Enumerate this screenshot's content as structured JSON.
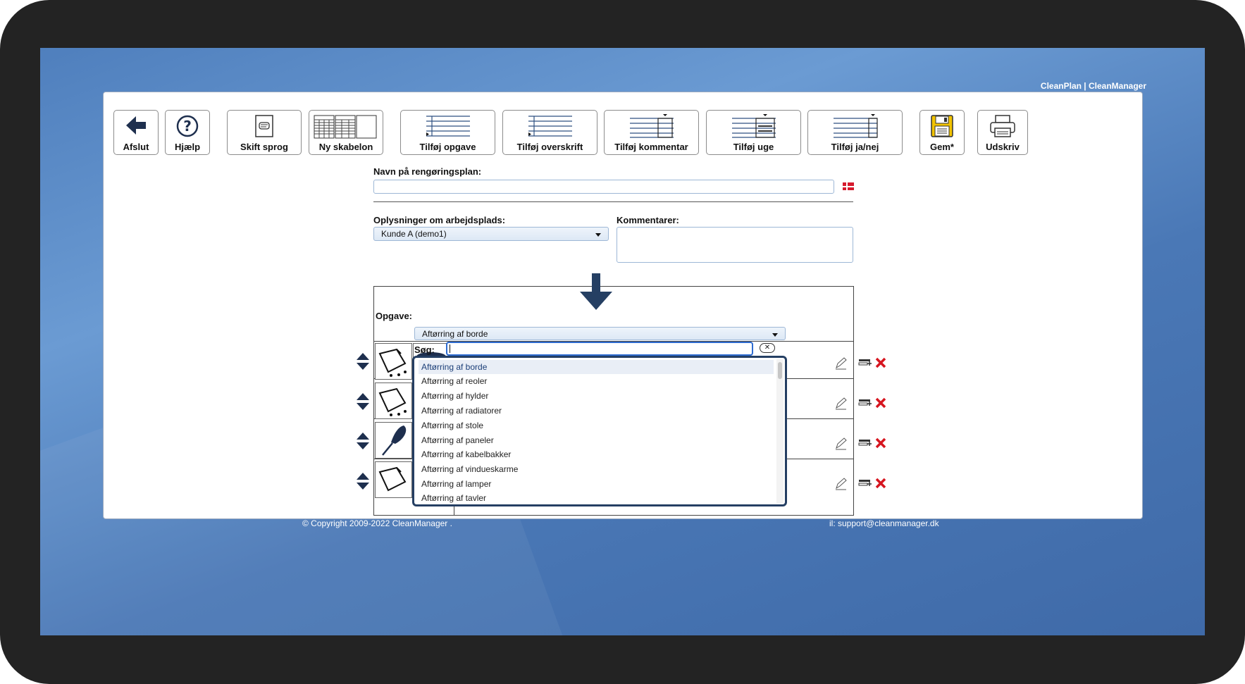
{
  "brand": "CleanPlan | CleanManager",
  "toolbar": {
    "exit": "Afslut",
    "help": "Hjælp",
    "language": "Skift sprog",
    "new_template": "Ny skabelon",
    "add_task": "Tilføj opgave",
    "add_heading": "Tilføj overskrift",
    "add_comment": "Tilføj kommentar",
    "add_week": "Tilføj uge",
    "add_yes_no": "Tilføj ja/nej",
    "save": "Gem*",
    "print": "Udskriv"
  },
  "form": {
    "plan_name_label": "Navn på rengøringsplan:",
    "plan_name_value": "",
    "workplace_label": "Oplysninger om arbejdsplads:",
    "workplace_value": "Kunde A (demo1)",
    "comments_label": "Kommentarer:",
    "comments_value": ""
  },
  "table": {
    "header": "Opgave:",
    "rows": [
      {
        "task": "Aftørring af borde",
        "icons": [
          "cloth-icon",
          "table-icon"
        ]
      },
      {
        "task": "",
        "icons": [
          "cloth-icon",
          "shelf-icon"
        ]
      },
      {
        "task": "",
        "icons": [
          "feather-duster-icon",
          "radiator-icon"
        ]
      },
      {
        "task": "",
        "icons": [
          "cloth-icon",
          "lamp-icon"
        ]
      }
    ]
  },
  "search": {
    "label": "Søg:",
    "value": "",
    "clear_icon": "clear-icon"
  },
  "dropdown": {
    "options": [
      "Aftørring af borde",
      "Aftørring af reoler",
      "Aftørring af hylder",
      "Aftørring af radiatorer",
      "Aftørring af stole",
      "Aftørring af paneler",
      "Aftørring af kabelbakker",
      "Aftørring af vindueskarme",
      "Aftørring af lamper",
      "Aftørring af tavler"
    ],
    "selected": "Aftørring af borde"
  },
  "footer": {
    "copyright": "© Copyright 2009-2022 CleanManager .",
    "email": "il: support@cleanmanager.dk"
  },
  "colors": {
    "desktop": "#5a8ac8",
    "accent": "#253f63",
    "delete": "#d6151f",
    "save_icon": "#f2c300"
  }
}
